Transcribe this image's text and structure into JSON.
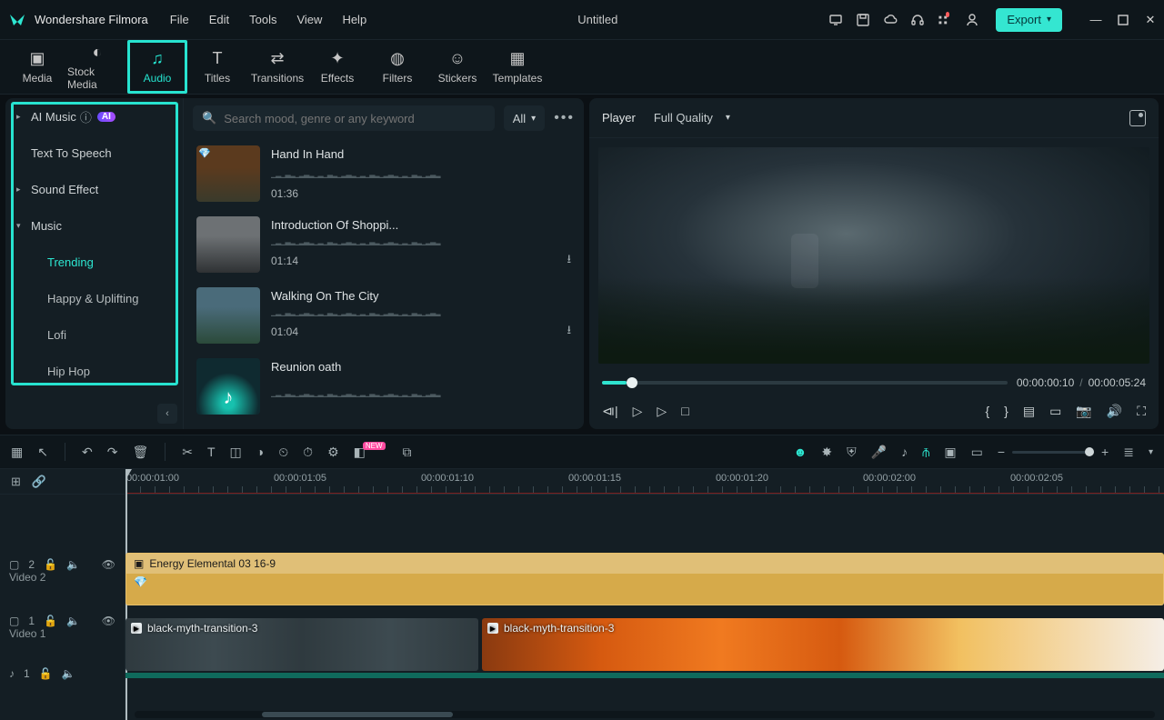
{
  "app": {
    "name": "Wondershare Filmora",
    "doc_title": "Untitled"
  },
  "menu": {
    "file": "File",
    "edit": "Edit",
    "tools": "Tools",
    "view": "View",
    "help": "Help"
  },
  "export": {
    "label": "Export"
  },
  "tabs": {
    "media": "Media",
    "stock": "Stock Media",
    "audio": "Audio",
    "titles": "Titles",
    "transitions": "Transitions",
    "effects": "Effects",
    "filters": "Filters",
    "stickers": "Stickers",
    "templates": "Templates"
  },
  "sidebar": {
    "ai_music": "AI Music",
    "ai_badge": "AI",
    "tts": "Text To Speech",
    "sound_effect": "Sound Effect",
    "music": "Music",
    "subs": {
      "trending": "Trending",
      "happy": "Happy & Uplifting",
      "lofi": "Lofi",
      "hiphop": "Hip Hop"
    }
  },
  "search": {
    "placeholder": "Search mood, genre or any keyword",
    "filter": "All"
  },
  "tracks": [
    {
      "title": "Hand In Hand",
      "dur": "01:36"
    },
    {
      "title": "Introduction Of Shoppi...",
      "dur": "01:14"
    },
    {
      "title": "Walking On The City",
      "dur": "01:04"
    },
    {
      "title": "Reunion oath",
      "dur": ""
    }
  ],
  "player": {
    "label": "Player",
    "quality": "Full Quality",
    "current": "00:00:00:10",
    "total": "00:00:05:24"
  },
  "ruler": {
    "labels": [
      "00:00:01:00",
      "00:00:01:05",
      "00:00:01:10",
      "00:00:01:15",
      "00:00:01:20",
      "00:00:02:00",
      "00:00:02:05"
    ]
  },
  "timeline": {
    "video2_label": "Video 2",
    "video1_label": "Video 1",
    "v2_badge": "2",
    "v1_badge": "1",
    "a1_badge": "1",
    "clip_energy": "Energy Elemental 03 16-9",
    "clip_v1a": "black-myth-transition-3",
    "clip_v1b": "black-myth-transition-3"
  },
  "toolbar": {
    "new_badge": "NEW"
  }
}
